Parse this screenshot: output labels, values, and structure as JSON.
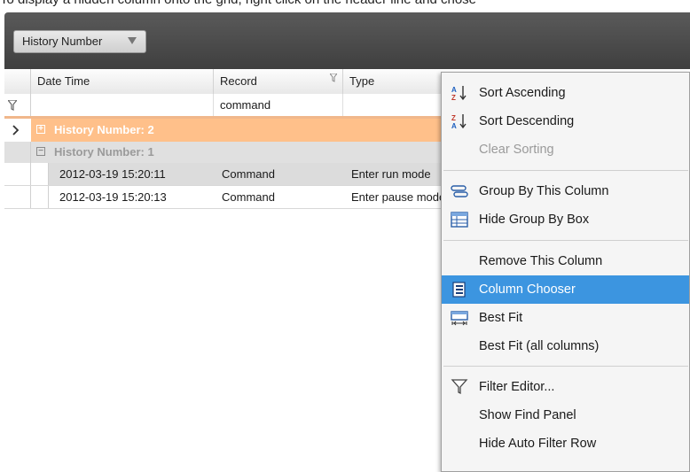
{
  "caption": "To display a hidden column onto the grid, right click on the header line and chose",
  "group_panel": {
    "chip_label": "History Number"
  },
  "columns": [
    {
      "label": "Date Time"
    },
    {
      "label": "Record"
    },
    {
      "label": "Type"
    }
  ],
  "filter_row": {
    "record_value": "command"
  },
  "groups": [
    {
      "label": "History Number: 2",
      "expanded": false,
      "toggle": "+"
    },
    {
      "label": "History Number: 1",
      "expanded": true,
      "toggle": "−"
    }
  ],
  "rows": [
    {
      "datetime": "2012-03-19 15:20:11",
      "record": "Command",
      "type": "Enter run mode",
      "selected": true
    },
    {
      "datetime": "2012-03-19 15:20:13",
      "record": "Command",
      "type": "Enter pause mode",
      "selected": false
    }
  ],
  "context_menu": {
    "items": [
      {
        "label": "Sort Ascending",
        "icon": "sort-ascending-icon",
        "disabled": false
      },
      {
        "label": "Sort Descending",
        "icon": "sort-descending-icon",
        "disabled": false
      },
      {
        "label": "Clear Sorting",
        "icon": "",
        "disabled": true
      },
      {
        "label": "Group By This Column",
        "icon": "group-by-icon",
        "disabled": false
      },
      {
        "label": "Hide Group By Box",
        "icon": "group-box-icon",
        "disabled": false
      },
      {
        "label": "Remove This Column",
        "icon": "",
        "disabled": false
      },
      {
        "label": "Column Chooser",
        "icon": "column-chooser-icon",
        "disabled": false,
        "active": true
      },
      {
        "label": "Best Fit",
        "icon": "best-fit-icon",
        "disabled": false
      },
      {
        "label": "Best Fit (all columns)",
        "icon": "",
        "disabled": false
      },
      {
        "label": "Filter Editor...",
        "icon": "filter-icon",
        "disabled": false
      },
      {
        "label": "Show Find Panel",
        "icon": "",
        "disabled": false
      },
      {
        "label": "Hide Auto Filter Row",
        "icon": "",
        "disabled": false
      }
    ]
  },
  "colors": {
    "group_row_highlight": "#ffc08a",
    "menu_active": "#3c95e0",
    "group_panel": "#4a4a4a"
  }
}
